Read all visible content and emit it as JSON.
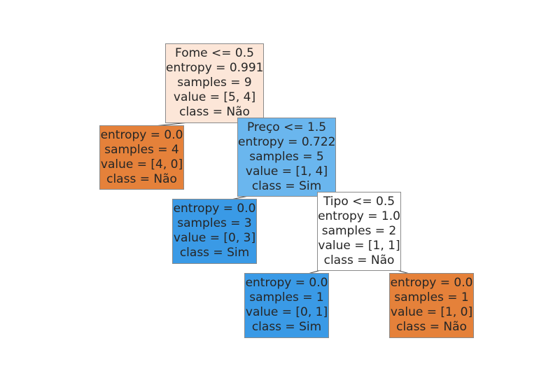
{
  "tree": {
    "nodes": [
      {
        "id": "root",
        "lines": [
          "Fome <= 0.5",
          "entropy = 0.991",
          "samples = 9",
          "value = [5, 4]",
          "class = Não"
        ],
        "fill": "#fce6d8"
      },
      {
        "id": "n1",
        "lines": [
          "entropy = 0.0",
          "samples = 4",
          "value = [4, 0]",
          "class = Não"
        ],
        "fill": "#e5813a"
      },
      {
        "id": "n2",
        "lines": [
          "Preço <= 1.5",
          "entropy = 0.722",
          "samples = 5",
          "value = [1, 4]",
          "class = Sim"
        ],
        "fill": "#6ab6ee"
      },
      {
        "id": "n3",
        "lines": [
          "entropy = 0.0",
          "samples = 3",
          "value = [0, 3]",
          "class = Sim"
        ],
        "fill": "#3a9ae6"
      },
      {
        "id": "n4",
        "lines": [
          "Tipo <= 0.5",
          "entropy = 1.0",
          "samples = 2",
          "value = [1, 1]",
          "class = Não"
        ],
        "fill": "#ffffff"
      },
      {
        "id": "n5",
        "lines": [
          "entropy = 0.0",
          "samples = 1",
          "value = [0, 1]",
          "class = Sim"
        ],
        "fill": "#3a9ae6"
      },
      {
        "id": "n6",
        "lines": [
          "entropy = 0.0",
          "samples = 1",
          "value = [1, 0]",
          "class = Não"
        ],
        "fill": "#e5813a"
      }
    ]
  }
}
